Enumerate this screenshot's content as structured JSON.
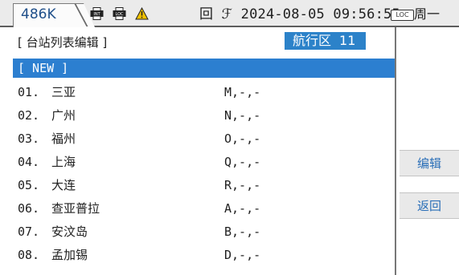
{
  "status_bar": {
    "frequency": "486K",
    "int_label": "INT",
    "loc_label": "LOC",
    "datetime": "回 ℱ 2024-08-05 09:56:55",
    "loc_badge": "LOC",
    "weekday": "周一"
  },
  "header": {
    "title": "[ 台站列表编辑 ]",
    "zone_label": "航行区",
    "zone_number": "11"
  },
  "list": {
    "new_item": "[ NEW ]",
    "rows": [
      {
        "num": "01.",
        "name": "三亚",
        "code": "M,-,-"
      },
      {
        "num": "02.",
        "name": "广州",
        "code": "N,-,-"
      },
      {
        "num": "03.",
        "name": "福州",
        "code": "O,-,-"
      },
      {
        "num": "04.",
        "name": "上海",
        "code": "Q,-,-"
      },
      {
        "num": "05.",
        "name": "大连",
        "code": "R,-,-"
      },
      {
        "num": "06.",
        "name": "查亚普拉",
        "code": "A,-,-"
      },
      {
        "num": "07.",
        "name": "安汶岛",
        "code": "B,-,-"
      },
      {
        "num": "08.",
        "name": "孟加锡",
        "code": "D,-,-"
      }
    ]
  },
  "side_buttons": {
    "edit_label": "编辑",
    "back_label": "返回"
  },
  "colors": {
    "accent": "#2c82c9",
    "warning": "#f2c200"
  }
}
